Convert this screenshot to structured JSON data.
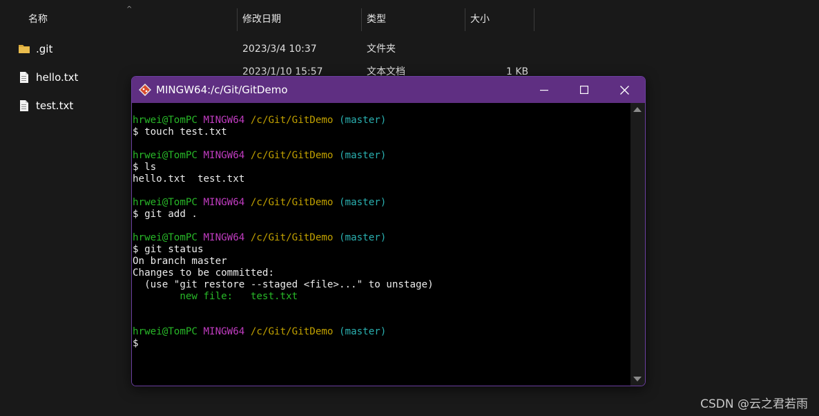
{
  "explorer": {
    "columns": {
      "name": "名称",
      "modified": "修改日期",
      "type": "类型",
      "size": "大小"
    },
    "files": [
      {
        "name": ".git",
        "icon": "folder-icon",
        "modified": "2023/3/4 10:37",
        "type": "文件夹",
        "size": ""
      },
      {
        "name": "hello.txt",
        "icon": "text-file-icon",
        "modified": "2023/1/10 15:57",
        "type": "文本文档",
        "size": "1 KB"
      },
      {
        "name": "test.txt",
        "icon": "text-file-icon",
        "modified": "",
        "type": "",
        "size": ""
      }
    ]
  },
  "terminal": {
    "title": "MINGW64:/c/Git/GitDemo",
    "prompt": {
      "user": "hrwei@TomPC",
      "host": "MINGW64",
      "path": "/c/Git/GitDemo",
      "branch": "(master)"
    },
    "commands": [
      "$ touch test.txt",
      "$ ls",
      "$ git add .",
      "$ git status",
      "$"
    ],
    "output": {
      "ls": "hello.txt  test.txt",
      "status_branch": "On branch master",
      "status_changes": "Changes to be committed:",
      "status_hint": "  (use \"git restore --staged <file>...\" to unstage)",
      "status_new_file": "        new file:   test.txt"
    }
  },
  "watermark": "CSDN @云之君若雨",
  "colors": {
    "titlebar": "#5f2f82",
    "user": "#28b828",
    "host": "#c03cc0",
    "path": "#c0a000",
    "branch": "#2ab0b0"
  }
}
